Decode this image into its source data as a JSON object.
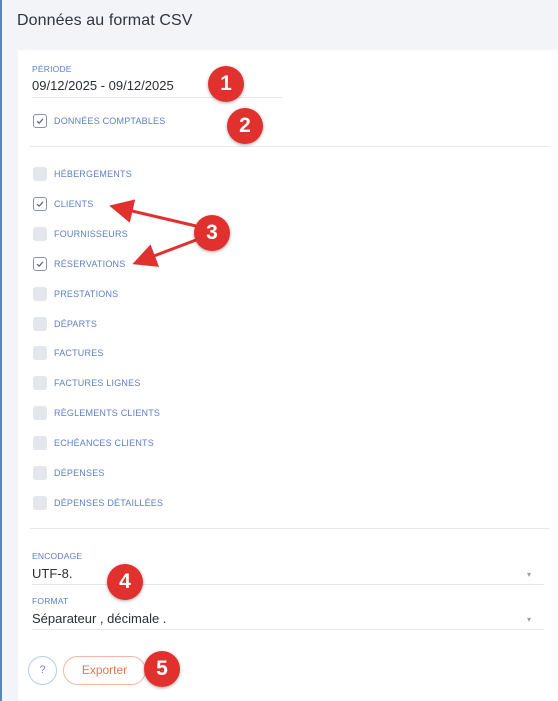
{
  "page": {
    "title": "Données au format CSV"
  },
  "periode": {
    "label": "PÉRIODE",
    "value": "09/12/2025 - 09/12/2025"
  },
  "comptables": {
    "label": "DONNÉES COMPTABLES",
    "checked": true
  },
  "datasets": [
    {
      "label": "HÉBERGEMENTS",
      "checked": false
    },
    {
      "label": "CLIENTS",
      "checked": true
    },
    {
      "label": "FOURNISSEURS",
      "checked": false
    },
    {
      "label": "RÉSERVATIONS",
      "checked": true
    },
    {
      "label": "PRESTATIONS",
      "checked": false
    },
    {
      "label": "DÉPARTS",
      "checked": false
    },
    {
      "label": "FACTURES",
      "checked": false
    },
    {
      "label": "FACTURES LIGNES",
      "checked": false
    },
    {
      "label": "RÈGLEMENTS CLIENTS",
      "checked": false
    },
    {
      "label": "ECHÉANCES CLIENTS",
      "checked": false
    },
    {
      "label": "DÉPENSES",
      "checked": false
    },
    {
      "label": "DÉPENSES DÉTAILLÉES",
      "checked": false
    }
  ],
  "encodage": {
    "label": "ENCODAGE",
    "value": "UTF-8."
  },
  "format": {
    "label": "FORMAT",
    "value": "Séparateur , décimale ."
  },
  "actions": {
    "help": "?",
    "export": "Exporter"
  },
  "annotations": [
    "1",
    "2",
    "3",
    "4",
    "5"
  ],
  "colors": {
    "accent": "#ea7650",
    "label_blue": "#5d7fc4",
    "badge_red": "#e0312f"
  }
}
